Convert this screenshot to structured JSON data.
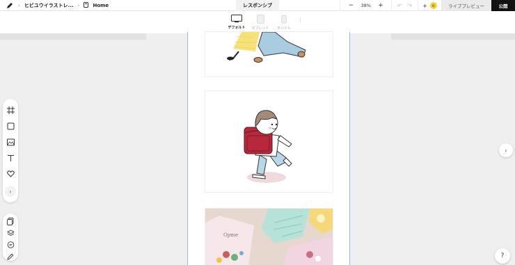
{
  "topbar": {
    "breadcrumbs": [
      "ヒビユウイラストレ...",
      "Home"
    ],
    "mode": "レスポンシブ",
    "zoom": "38%",
    "zoom_out": "−",
    "zoom_in": "+",
    "avatar_initial": "ヒ",
    "preview_label": "ライブプレビュー",
    "publish_label": "公開"
  },
  "devices": {
    "items": [
      {
        "label": "デフォルト",
        "active": true
      },
      {
        "label": "タブレット",
        "active": false
      },
      {
        "label": "モバイル",
        "active": false
      }
    ],
    "more": "⋮"
  },
  "card3": {
    "caption": "Opme"
  },
  "help": {
    "label": "?"
  },
  "icons": {
    "right_collapse": "‹",
    "expand": "›"
  },
  "colors": {
    "frame_border": "#9db4e6",
    "backpack_red": "#b8283c",
    "publish_bg": "#111111",
    "avatar_bg": "#f2d33a"
  }
}
